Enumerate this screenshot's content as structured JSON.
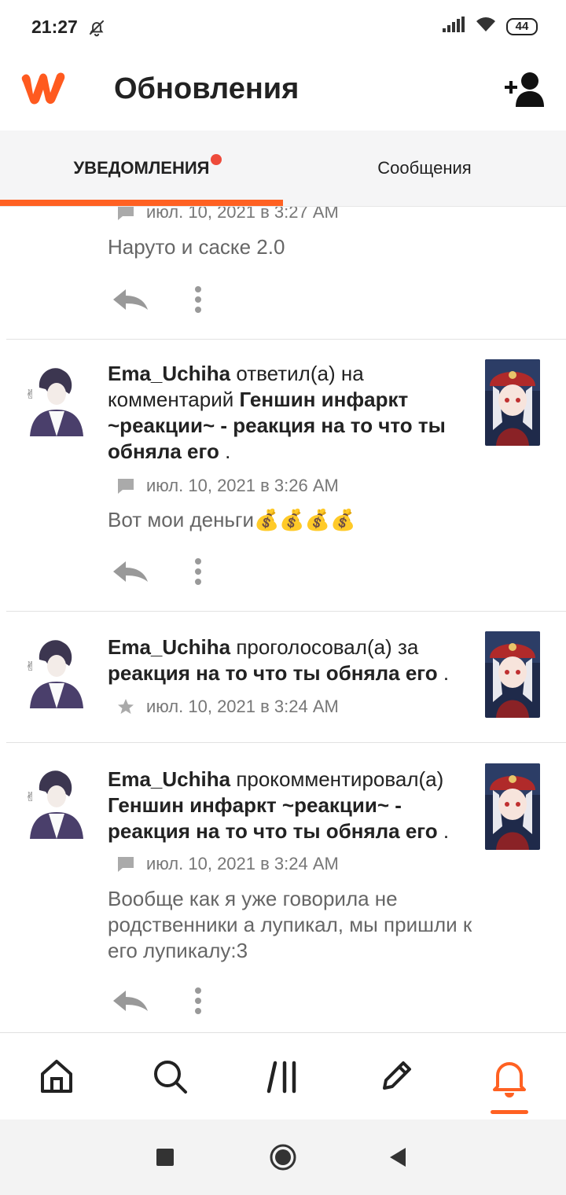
{
  "status": {
    "time": "21:27",
    "battery": "44"
  },
  "header": {
    "title": "Обновления"
  },
  "tabs": [
    {
      "label": "УВЕДОМЛЕНИЯ",
      "active": true,
      "has_badge": true
    },
    {
      "label": "Сообщения",
      "active": false
    }
  ],
  "colors": {
    "accent": "#ff6122",
    "badge": "#ee4b3b"
  },
  "items": [
    {
      "partial": true,
      "meta_icon": "comment-icon",
      "timestamp": "июл. 10, 2021 в 3:27 AM",
      "comment": "Наруто и саске 2.0"
    },
    {
      "user": "Ema_Uchiha",
      "action": "ответил(а) на комментарий",
      "target": "Геншин инфаркт ~реакции~ - реакция на то что ты обняла его",
      "suffix": ".",
      "meta_icon": "comment-icon",
      "timestamp": "июл. 10, 2021 в 3:26 AM",
      "comment": "Вот мои деньги💰💰💰💰"
    },
    {
      "user": "Ema_Uchiha",
      "action": "проголосовал(а) за",
      "target": "реакция на то что ты обняла его",
      "suffix": ".",
      "meta_icon": "star-icon",
      "timestamp": "июл. 10, 2021 в 3:24 AM"
    },
    {
      "user": "Ema_Uchiha",
      "action": "прокомментировал(а)",
      "target": "Геншин инфаркт ~реакции~ - реакция на то что ты обняла его",
      "suffix": ".",
      "meta_icon": "comment-icon",
      "timestamp": "июл. 10, 2021 в 3:24 AM",
      "comment": "Вообще как я уже говорила не родственники а лупикал, мы пришли к его лупикалу:3"
    }
  ],
  "bottom_nav": [
    {
      "icon": "home-icon",
      "active": false
    },
    {
      "icon": "search-icon",
      "active": false
    },
    {
      "icon": "library-icon",
      "active": false
    },
    {
      "icon": "write-icon",
      "active": false
    },
    {
      "icon": "bell-icon",
      "active": true
    }
  ]
}
